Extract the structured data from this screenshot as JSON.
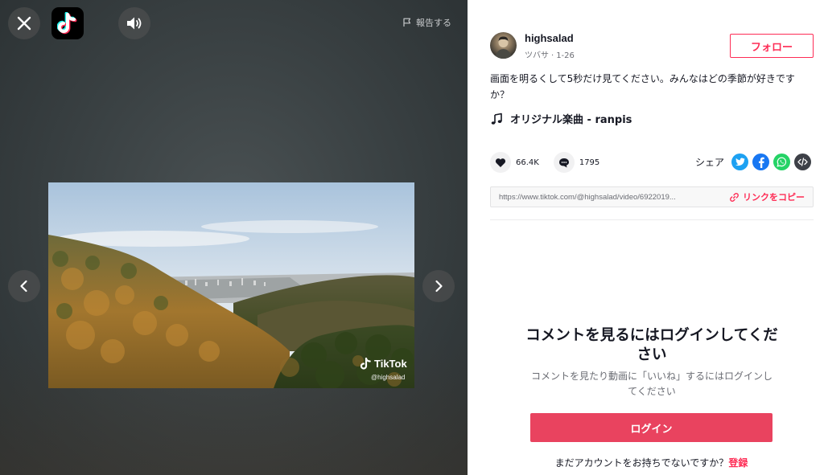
{
  "player": {
    "report_label": "報告する",
    "watermark": {
      "brand": "TikTok",
      "user": "@highsalad"
    }
  },
  "author": {
    "username": "highsalad",
    "display_name": "ツバサ",
    "date": "1-26",
    "follow_label": "フォロー"
  },
  "post": {
    "description": "画面を明るくして5秒だけ見てください。みんなはどの季節が好きですか？",
    "music": "オリジナル楽曲 - ranpis"
  },
  "stats": {
    "likes": "66.4K",
    "comments": "1795"
  },
  "share": {
    "label": "シェア",
    "platforms": [
      "twitter-icon",
      "facebook-icon",
      "whatsapp-icon",
      "embed-icon"
    ]
  },
  "link": {
    "url": "https://www.tiktok.com/@highsalad/video/6922019...",
    "copy_label": "リンクをコピー"
  },
  "login_prompt": {
    "title": "コメントを見るにはログインしてください",
    "subtitle": "コメントを見たり動画に「いいね」するにはログインしてください",
    "button_label": "ログイン",
    "signup_text": "まだアカウントをお持ちでないですか？",
    "signup_link": "登録"
  },
  "colors": {
    "accent": "#fe2c55",
    "login_button": "#e9435f",
    "twitter": "#1da1f2",
    "facebook": "#1877f2",
    "whatsapp": "#25d366",
    "embed": "#3d4047"
  }
}
